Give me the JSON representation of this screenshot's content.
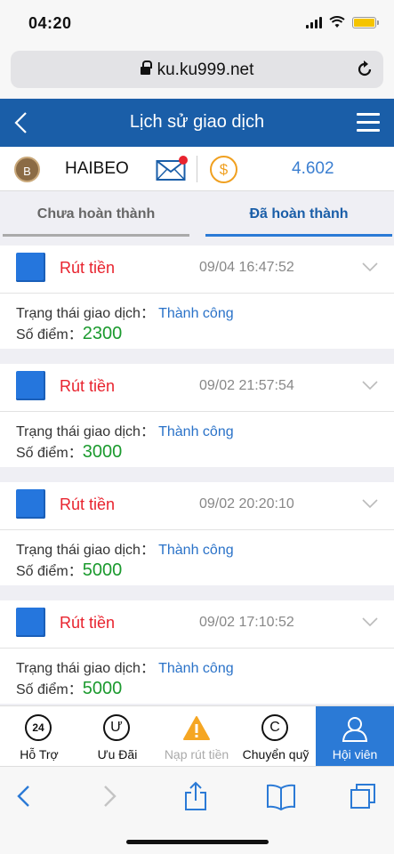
{
  "status_bar": {
    "time": "04:20"
  },
  "browser": {
    "url": "ku.ku999.net"
  },
  "header": {
    "title": "Lịch sử giao dịch"
  },
  "user": {
    "avatar_letter": "B",
    "name": "HAIBEO",
    "coin_symbol": "$",
    "balance": "4.602"
  },
  "tabs": [
    {
      "label": "Chưa hoàn thành",
      "active": false
    },
    {
      "label": "Đã hoàn thành",
      "active": true
    }
  ],
  "labels": {
    "status": "Trạng thái giao dịch：",
    "points": "Số điểm："
  },
  "transactions": [
    {
      "type": "Rút tiền",
      "time": "09/04 16:47:52",
      "status": "Thành công",
      "points": "2300"
    },
    {
      "type": "Rút tiền",
      "time": "09/02 21:57:54",
      "status": "Thành công",
      "points": "3000"
    },
    {
      "type": "Rút tiền",
      "time": "09/02 20:20:10",
      "status": "Thành công",
      "points": "5000"
    },
    {
      "type": "Rút tiền",
      "time": "09/02 17:10:52",
      "status": "Thành công",
      "points": "5000"
    }
  ],
  "bottom_nav": [
    {
      "label": "Hỗ Trợ",
      "icon": "support-24-icon",
      "glyph": "24"
    },
    {
      "label": "Ưu Đãi",
      "icon": "promo-icon",
      "glyph": "Ư"
    },
    {
      "label": "Nạp rút tiền",
      "icon": "warning-icon",
      "glyph": "!"
    },
    {
      "label": "Chuyển quỹ",
      "icon": "transfer-icon",
      "glyph": "C"
    },
    {
      "label": "Hội viên",
      "icon": "member-icon",
      "active": true
    }
  ],
  "colors": {
    "brand_blue": "#1a5ea8",
    "accent_blue": "#2b7ad6",
    "withdraw_red": "#e8232e",
    "points_green": "#1b9a2e",
    "coin_orange": "#f0a020"
  }
}
